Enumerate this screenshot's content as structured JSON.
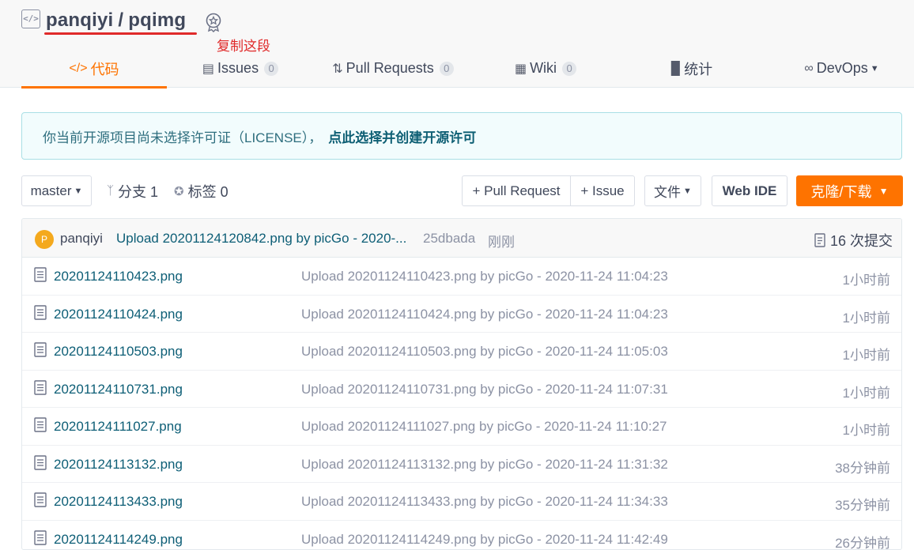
{
  "repo": {
    "owner": "panqiyi",
    "separator": "/",
    "name": "pqimg",
    "annotation": "复制这段"
  },
  "tabs": [
    {
      "label": "代码",
      "icon": "code-icon",
      "active": true
    },
    {
      "label": "Issues",
      "count": "0",
      "icon": "issues-icon"
    },
    {
      "label": "Pull Requests",
      "count": "0",
      "icon": "pull-request-icon"
    },
    {
      "label": "Wiki",
      "count": "0",
      "icon": "wiki-icon"
    },
    {
      "label": "统计",
      "icon": "stats-icon"
    },
    {
      "label": "DevOps",
      "icon": "devops-icon"
    }
  ],
  "notice": {
    "text": "你当前开源项目尚未选择许可证（LICENSE），",
    "link": "点此选择并创建开源许可"
  },
  "toolbar": {
    "branch": "master",
    "branches": "分支 1",
    "tags": "标签 0",
    "new_pr": "+ Pull Request",
    "new_issue": "+ Issue",
    "file": "文件",
    "web_ide": "Web IDE",
    "clone": "克隆/下载"
  },
  "last_commit": {
    "avatar": "P",
    "author": "panqiyi",
    "message": "Upload 20201124120842.png by picGo - 2020-...",
    "sha": "25dbada",
    "time": "刚刚",
    "count": "16 次提交"
  },
  "files": [
    {
      "name": "20201124110423.png",
      "message": "Upload 20201124110423.png by picGo - 2020-11-24 11:04:23",
      "time": "1小时前"
    },
    {
      "name": "20201124110424.png",
      "message": "Upload 20201124110424.png by picGo - 2020-11-24 11:04:23",
      "time": "1小时前"
    },
    {
      "name": "20201124110503.png",
      "message": "Upload 20201124110503.png by picGo - 2020-11-24 11:05:03",
      "time": "1小时前"
    },
    {
      "name": "20201124110731.png",
      "message": "Upload 20201124110731.png by picGo - 2020-11-24 11:07:31",
      "time": "1小时前"
    },
    {
      "name": "20201124111027.png",
      "message": "Upload 20201124111027.png by picGo - 2020-11-24 11:10:27",
      "time": "1小时前"
    },
    {
      "name": "20201124113132.png",
      "message": "Upload 20201124113132.png by picGo - 2020-11-24 11:31:32",
      "time": "38分钟前"
    },
    {
      "name": "20201124113433.png",
      "message": "Upload 20201124113433.png by picGo - 2020-11-24 11:34:33",
      "time": "35分钟前"
    },
    {
      "name": "20201124114249.png",
      "message": "Upload 20201124114249.png by picGo - 2020-11-24 11:42:49",
      "time": "26分钟前"
    }
  ],
  "colors": {
    "accent": "#fe7300",
    "link": "#0d5e76",
    "annotation": "#e02a2a"
  }
}
